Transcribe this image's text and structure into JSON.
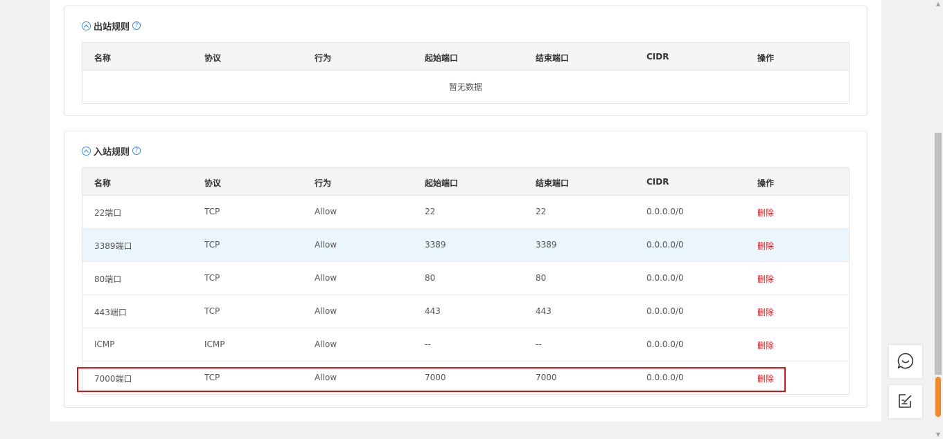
{
  "outbound": {
    "title": "出站规则",
    "help": "?",
    "columns": [
      "名称",
      "协议",
      "行为",
      "起始端口",
      "结束端口",
      "CIDR",
      "操作"
    ],
    "empty_text": "暂无数据"
  },
  "inbound": {
    "title": "入站规则",
    "help": "?",
    "columns": [
      "名称",
      "协议",
      "行为",
      "起始端口",
      "结束端口",
      "CIDR",
      "操作"
    ],
    "rows": [
      {
        "name": "22端口",
        "protocol": "TCP",
        "action": "Allow",
        "start": "22",
        "end": "22",
        "cidr": "0.0.0.0/0",
        "op": "删除"
      },
      {
        "name": "3389端口",
        "protocol": "TCP",
        "action": "Allow",
        "start": "3389",
        "end": "3389",
        "cidr": "0.0.0.0/0",
        "op": "删除"
      },
      {
        "name": "80端口",
        "protocol": "TCP",
        "action": "Allow",
        "start": "80",
        "end": "80",
        "cidr": "0.0.0.0/0",
        "op": "删除"
      },
      {
        "name": "443端口",
        "protocol": "TCP",
        "action": "Allow",
        "start": "443",
        "end": "443",
        "cidr": "0.0.0.0/0",
        "op": "删除"
      },
      {
        "name": "ICMP",
        "protocol": "ICMP",
        "action": "Allow",
        "start": "--",
        "end": "--",
        "cidr": "0.0.0.0/0",
        "op": "删除"
      },
      {
        "name": "7000端口",
        "protocol": "TCP",
        "action": "Allow",
        "start": "7000",
        "end": "7000",
        "cidr": "0.0.0.0/0",
        "op": "删除"
      }
    ]
  },
  "icons": {
    "collapse": "chevron-up-circle-icon",
    "help": "question-circle-icon",
    "chat": "smile-chat-icon",
    "note": "edit-note-icon"
  },
  "colors": {
    "accent": "#3a8ee6",
    "delete": "#e02020",
    "highlight": "#e01010",
    "row_hover": "#ebf5fc"
  }
}
